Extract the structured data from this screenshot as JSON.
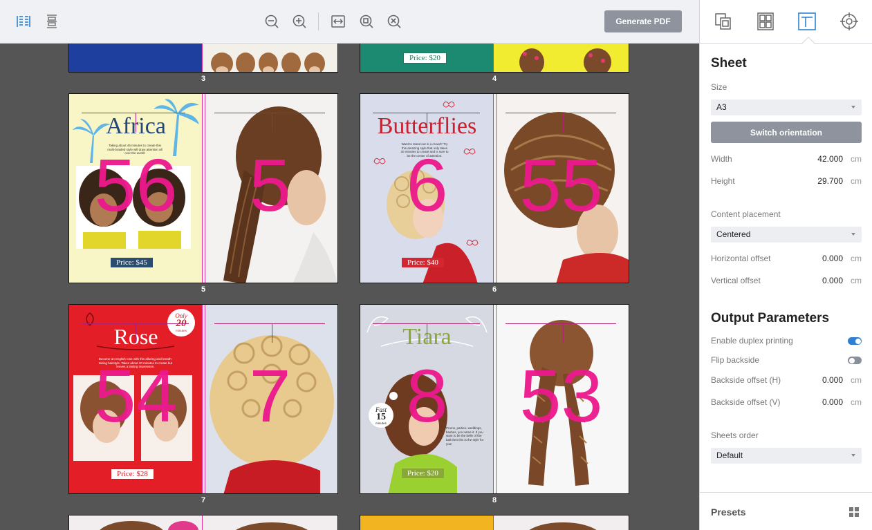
{
  "toolbar": {
    "generate_label": "Generate PDF",
    "icons": [
      "layout-columns-icon",
      "layout-rows-icon",
      "zoom-out-icon",
      "zoom-in-icon",
      "fit-width-icon",
      "fit-page-icon",
      "zoom-reset-icon"
    ]
  },
  "sheets": [
    {
      "label": "3",
      "left_num": "",
      "right_num": ""
    },
    {
      "label": "4",
      "left_price": "Price: $20"
    },
    {
      "label": "5",
      "left_title": "Africa",
      "left_num": "56",
      "right_num": "5",
      "left_price": "Price: $45",
      "blurb": "Taking about 45 minutes to create this multi-braided style will draw attention all over the world!"
    },
    {
      "label": "6",
      "left_title": "Butterflies",
      "left_num": "6",
      "right_num": "55",
      "left_price": "Price: $40",
      "blurb": "Want to stand out in a crowd? Try this amazing style that only takes 30 minutes to create and is sure to be the center of attention."
    },
    {
      "label": "7",
      "left_title": "Rose",
      "left_num": "54",
      "right_num": "7",
      "left_price": "Price: $28",
      "badge_top": "Only",
      "badge_num": "20",
      "badge_bottom": "minutes",
      "blurb": "Become an English rose with this alluring and breath-taking hairstyle. Takes about 20 minutes to create but leaves a lasting impression."
    },
    {
      "label": "8",
      "left_title": "Tiara",
      "left_num": "8",
      "right_num": "53",
      "left_price": "Price: $20",
      "badge_top": "Fast",
      "badge_num": "15",
      "badge_bottom": "minutes",
      "blurb": "Proms, parties, weddings, bashes, you name it. If you want to be the belle of the ball then this is the style for you!"
    }
  ],
  "panel": {
    "tabs": [
      "duplicate-pages-icon",
      "grid-layout-icon",
      "sheet-layout-icon",
      "crosshair-target-icon"
    ],
    "sheet_section": {
      "title": "Sheet",
      "size_label": "Size",
      "size_value": "A3",
      "switch_label": "Switch orientation",
      "width_label": "Width",
      "width_value": "42.000",
      "width_unit": "cm",
      "height_label": "Height",
      "height_value": "29.700",
      "height_unit": "cm",
      "placement_label": "Content placement",
      "placement_value": "Centered",
      "hoffset_label": "Horizontal offset",
      "hoffset_value": "0.000",
      "hoffset_unit": "cm",
      "voffset_label": "Vertical offset",
      "voffset_value": "0.000",
      "voffset_unit": "cm"
    },
    "output_section": {
      "title": "Output Parameters",
      "duplex_label": "Enable duplex printing",
      "duplex_on": true,
      "flip_label": "Flip backside",
      "flip_on": false,
      "bh_label": "Backside offset (H)",
      "bh_value": "0.000",
      "bh_unit": "cm",
      "bv_label": "Backside offset (V)",
      "bv_value": "0.000",
      "bv_unit": "cm",
      "order_label": "Sheets order",
      "order_value": "Default"
    },
    "presets_label": "Presets"
  },
  "colors": {
    "accent": "#2f80d0",
    "magenta": "#ec1a8c",
    "toggle_on": "#2f80d0",
    "toggle_off": "#8a8f99"
  }
}
